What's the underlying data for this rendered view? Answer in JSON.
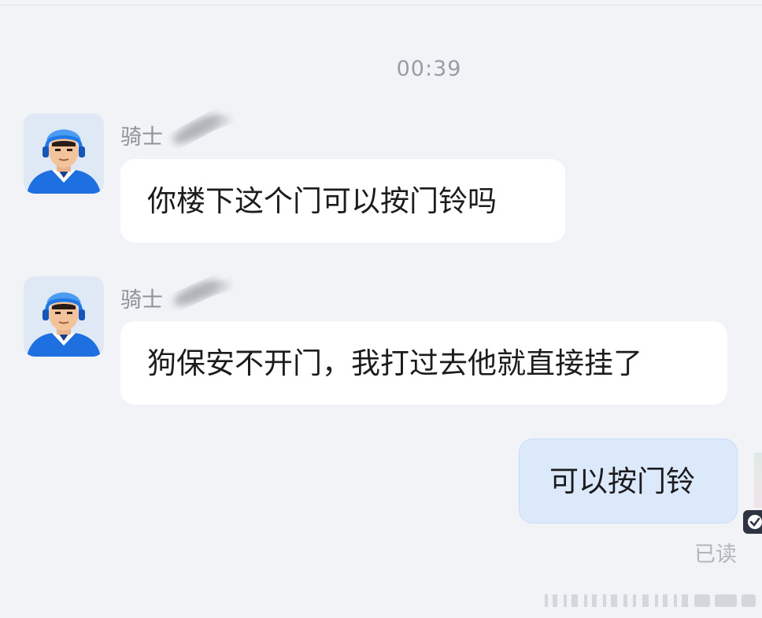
{
  "chat": {
    "timestamp": "00:39",
    "messages": [
      {
        "direction": "incoming",
        "sender": "骑士",
        "text": "你楼下这个门可以按门铃吗"
      },
      {
        "direction": "incoming",
        "sender": "骑士",
        "text": "狗保安不开门，我打过去他就直接挂了"
      },
      {
        "direction": "outgoing",
        "text": "可以按门铃",
        "status": "已读"
      }
    ]
  },
  "colors": {
    "background": "#f2f3f7",
    "incoming_bubble": "#ffffff",
    "outgoing_bubble": "#dce9fb",
    "avatar_accent": "#1e6fe0"
  },
  "icons": {
    "avatar": "rider-helmet-avatar",
    "name_redaction": "blurred-name",
    "edge_badge": "check-badge-icon"
  }
}
